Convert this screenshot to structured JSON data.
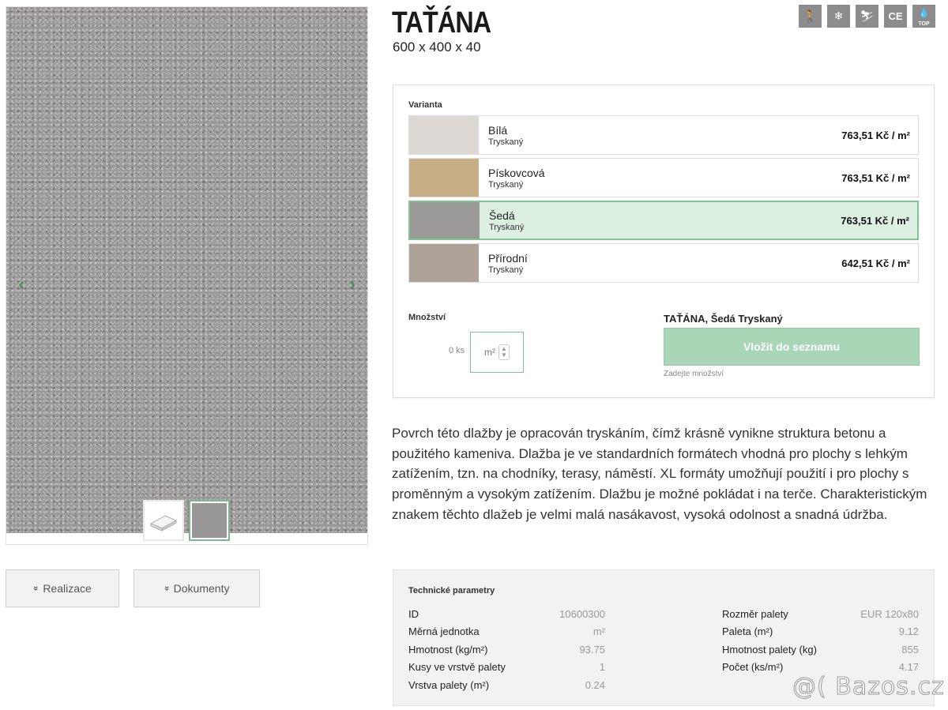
{
  "product": {
    "title": "TAŤÁNA",
    "dimensions": "600 x 400 x 40"
  },
  "gallery": {
    "prev_arrow": "‹",
    "next_arrow": "›",
    "thumbnails": [
      "tile-profile-icon",
      "gray-surface-swatch"
    ],
    "selected_thumbnail": 2
  },
  "feature_icons": [
    {
      "name": "pedestrian-icon",
      "glyph": "🚶"
    },
    {
      "name": "frost-resistant-icon",
      "glyph": "❄"
    },
    {
      "name": "anti-slip-icon",
      "glyph": "⛷"
    },
    {
      "name": "ce-mark-icon",
      "glyph": "CE"
    },
    {
      "name": "top-water-drop-icon",
      "glyph": "💧",
      "sub": "TOP"
    }
  ],
  "variants": {
    "label": "Varianta",
    "items": [
      {
        "name": "Bílá",
        "finish": "Tryskaný",
        "price": "763,51 Kč / m²",
        "color": "#dcd8d4"
      },
      {
        "name": "Pískovcová",
        "finish": "Tryskaný",
        "price": "763,51 Kč / m²",
        "color": "#c6ae86"
      },
      {
        "name": "Šedá",
        "finish": "Tryskaný",
        "price": "763,51 Kč / m²",
        "color": "#9b9a98",
        "selected": true
      },
      {
        "name": "Přírodní",
        "finish": "Tryskaný",
        "price": "642,51 Kč / m²",
        "color": "#ada399"
      }
    ]
  },
  "quantity": {
    "label": "Množství",
    "ks_text": "0 ks",
    "unit": "m²",
    "up": "▲",
    "down": "▼"
  },
  "selection": {
    "title": "TAŤÁNA, Šedá Tryskaný",
    "add_button": "Vložit do seznamu",
    "hint": "Zadejte množství"
  },
  "actions": {
    "realizace": "Realizace",
    "dokumenty": "Dokumenty",
    "chevron": "»"
  },
  "description": "Povrch této dlažby je opracován tryskáním, čímž krásně vynikne struktura betonu a použitého kameniva. Dlažba je ve standardních formátech vhodná pro plochy s lehkým zatížením, tzn. na chodníky, terasy, náměstí. XL formáty umožňují použití i pro plochy s proměnným a vysokým zatížením. Dlažbu je možné pokládat i na terče. Charakteristickým znakem těchto dlažeb je velmi malá nasákavost, vysoká odolnost a snadná údržba.",
  "tech": {
    "title": "Technické parametry",
    "left": [
      {
        "name": "ID",
        "value": "10600300"
      },
      {
        "name": "Měrná jednotka",
        "value": "m²"
      },
      {
        "name": "Hmotnost (kg/m²)",
        "value": "93.75"
      },
      {
        "name": "Kusy ve vrstvě palety",
        "value": "1"
      },
      {
        "name": "Vrstva palety (m²)",
        "value": "0.24"
      }
    ],
    "right": [
      {
        "name": "Rozměr palety",
        "value": "EUR 120x80"
      },
      {
        "name": "Paleta (m²)",
        "value": "9.12"
      },
      {
        "name": "Hmotnost palety (kg)",
        "value": "855"
      },
      {
        "name": "Počet (ks/m²)",
        "value": "4.17"
      }
    ]
  },
  "watermark": "@( Bazos.cz"
}
